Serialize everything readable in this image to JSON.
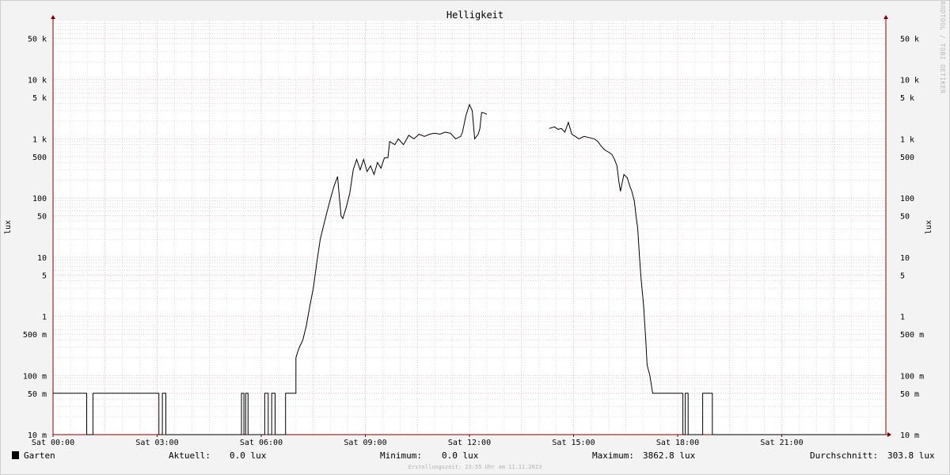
{
  "chart_data": {
    "type": "line",
    "title": "Helligkeit",
    "ylabel": "lux",
    "y_scale": "log",
    "ylim": [
      0.01,
      100000
    ],
    "xlim_hours": [
      0,
      24
    ],
    "x_ticks": [
      {
        "hour": 0,
        "label": "Sat 00:00"
      },
      {
        "hour": 3,
        "label": "Sat 03:00"
      },
      {
        "hour": 6,
        "label": "Sat 06:00"
      },
      {
        "hour": 9,
        "label": "Sat 09:00"
      },
      {
        "hour": 12,
        "label": "Sat 12:00"
      },
      {
        "hour": 15,
        "label": "Sat 15:00"
      },
      {
        "hour": 18,
        "label": "Sat 18:00"
      },
      {
        "hour": 21,
        "label": "Sat 21:00"
      }
    ],
    "y_ticks": [
      {
        "value": 0.01,
        "label": "10 m"
      },
      {
        "value": 0.05,
        "label": "50 m"
      },
      {
        "value": 0.1,
        "label": "100 m"
      },
      {
        "value": 0.5,
        "label": "500 m"
      },
      {
        "value": 1,
        "label": "1"
      },
      {
        "value": 5,
        "label": "5"
      },
      {
        "value": 10,
        "label": "10"
      },
      {
        "value": 50,
        "label": "50"
      },
      {
        "value": 100,
        "label": "100"
      },
      {
        "value": 500,
        "label": "500"
      },
      {
        "value": 1000,
        "label": "1 k"
      },
      {
        "value": 5000,
        "label": "5 k"
      },
      {
        "value": 10000,
        "label": "10 k"
      },
      {
        "value": 50000,
        "label": "50 k"
      }
    ],
    "grid": true,
    "series": [
      {
        "name": "Garten",
        "color": "#000000",
        "points": [
          [
            0.0,
            0.05
          ],
          [
            0.97,
            0.05
          ],
          [
            0.97,
            0.01
          ],
          [
            1.15,
            0.01
          ],
          [
            1.15,
            0.05
          ],
          [
            3.05,
            0.05
          ],
          [
            3.05,
            0.01
          ],
          [
            3.15,
            0.01
          ],
          [
            3.15,
            0.05
          ],
          [
            3.25,
            0.05
          ],
          [
            3.25,
            0.01
          ],
          [
            5.43,
            0.01
          ],
          [
            5.43,
            0.05
          ],
          [
            5.5,
            0.05
          ],
          [
            5.5,
            0.01
          ],
          [
            5.55,
            0.01
          ],
          [
            5.55,
            0.05
          ],
          [
            5.62,
            0.05
          ],
          [
            5.62,
            0.01
          ],
          [
            6.1,
            0.01
          ],
          [
            6.1,
            0.05
          ],
          [
            6.2,
            0.05
          ],
          [
            6.2,
            0.01
          ],
          [
            6.3,
            0.01
          ],
          [
            6.3,
            0.05
          ],
          [
            6.4,
            0.05
          ],
          [
            6.4,
            0.01
          ],
          [
            6.7,
            0.01
          ],
          [
            6.7,
            0.05
          ],
          [
            7.0,
            0.05
          ],
          [
            7.0,
            0.2
          ],
          [
            7.05,
            0.25
          ],
          [
            7.1,
            0.3
          ],
          [
            7.2,
            0.4
          ],
          [
            7.3,
            0.7
          ],
          [
            7.4,
            1.5
          ],
          [
            7.5,
            3
          ],
          [
            7.6,
            8
          ],
          [
            7.7,
            20
          ],
          [
            7.8,
            35
          ],
          [
            7.9,
            60
          ],
          [
            8.0,
            100
          ],
          [
            8.1,
            160
          ],
          [
            8.2,
            230
          ],
          [
            8.3,
            50
          ],
          [
            8.35,
            45
          ],
          [
            8.45,
            70
          ],
          [
            8.55,
            120
          ],
          [
            8.65,
            300
          ],
          [
            8.75,
            450
          ],
          [
            8.85,
            300
          ],
          [
            8.95,
            450
          ],
          [
            9.05,
            280
          ],
          [
            9.15,
            350
          ],
          [
            9.25,
            250
          ],
          [
            9.35,
            400
          ],
          [
            9.45,
            320
          ],
          [
            9.55,
            480
          ],
          [
            9.65,
            480
          ],
          [
            9.7,
            900
          ],
          [
            9.85,
            800
          ],
          [
            9.95,
            1000
          ],
          [
            10.1,
            800
          ],
          [
            10.25,
            1150
          ],
          [
            10.4,
            1000
          ],
          [
            10.55,
            1200
          ],
          [
            10.7,
            1100
          ],
          [
            10.85,
            1200
          ],
          [
            11.0,
            1250
          ],
          [
            11.15,
            1200
          ],
          [
            11.3,
            1300
          ],
          [
            11.45,
            1250
          ],
          [
            11.6,
            1000
          ],
          [
            11.75,
            1100
          ],
          [
            11.8,
            1300
          ],
          [
            11.9,
            2500
          ],
          [
            12.0,
            3800
          ],
          [
            12.08,
            3000
          ],
          [
            12.15,
            1000
          ],
          [
            12.25,
            1200
          ],
          [
            12.3,
            1500
          ],
          [
            12.35,
            2800
          ],
          [
            12.45,
            2700
          ],
          [
            12.5,
            2600
          ]
        ]
      },
      {
        "name": "Garten",
        "color": "#000000",
        "points": [
          [
            14.3,
            1500
          ],
          [
            14.45,
            1600
          ],
          [
            14.55,
            1450
          ],
          [
            14.65,
            1500
          ],
          [
            14.75,
            1300
          ],
          [
            14.85,
            1900
          ],
          [
            14.95,
            1200
          ],
          [
            15.05,
            1100
          ],
          [
            15.15,
            1000
          ],
          [
            15.3,
            1100
          ],
          [
            15.45,
            1050
          ],
          [
            15.6,
            1000
          ],
          [
            15.7,
            900
          ],
          [
            15.8,
            750
          ],
          [
            15.9,
            650
          ],
          [
            16.0,
            600
          ],
          [
            16.1,
            550
          ],
          [
            16.18,
            450
          ],
          [
            16.25,
            350
          ],
          [
            16.3,
            200
          ],
          [
            16.35,
            130
          ],
          [
            16.45,
            250
          ],
          [
            16.55,
            220
          ],
          [
            16.62,
            160
          ],
          [
            16.68,
            130
          ],
          [
            16.75,
            90
          ],
          [
            16.8,
            50
          ],
          [
            16.85,
            30
          ],
          [
            16.9,
            10
          ],
          [
            16.95,
            4
          ],
          [
            17.02,
            1.5
          ],
          [
            17.08,
            0.4
          ],
          [
            17.12,
            0.15
          ],
          [
            17.2,
            0.1
          ],
          [
            17.28,
            0.05
          ],
          [
            17.35,
            0.05
          ],
          [
            18.15,
            0.05
          ],
          [
            18.15,
            0.01
          ],
          [
            18.22,
            0.01
          ],
          [
            18.22,
            0.05
          ],
          [
            18.3,
            0.05
          ],
          [
            18.3,
            0.01
          ],
          [
            18.72,
            0.01
          ],
          [
            18.72,
            0.05
          ],
          [
            19.0,
            0.05
          ],
          [
            19.0,
            0.01
          ],
          [
            24.0,
            0.01
          ]
        ]
      }
    ]
  },
  "legend": {
    "series_name": "Garten",
    "swatch_color": "#000000",
    "current_label": "Aktuell:",
    "current_value": "0.0 lux",
    "min_label": "Minimum:",
    "min_value": "0.0 lux",
    "max_label": "Maximum:",
    "max_value": "3862.8 lux",
    "avg_label": "Durchschnitt:",
    "avg_value": "303.8 lux"
  },
  "watermark": "RRDTOOL / TOBI OETIKER",
  "footer": "Erstellungszeit: 23:55 Uhr am 11.11.2023",
  "colors": {
    "background": "#f3f3f3",
    "plot_bg": "#ffffff",
    "major_grid": "#e8a0a0",
    "minor_grid": "#c8c8c8",
    "axis": "#800000",
    "line": "#000000"
  }
}
